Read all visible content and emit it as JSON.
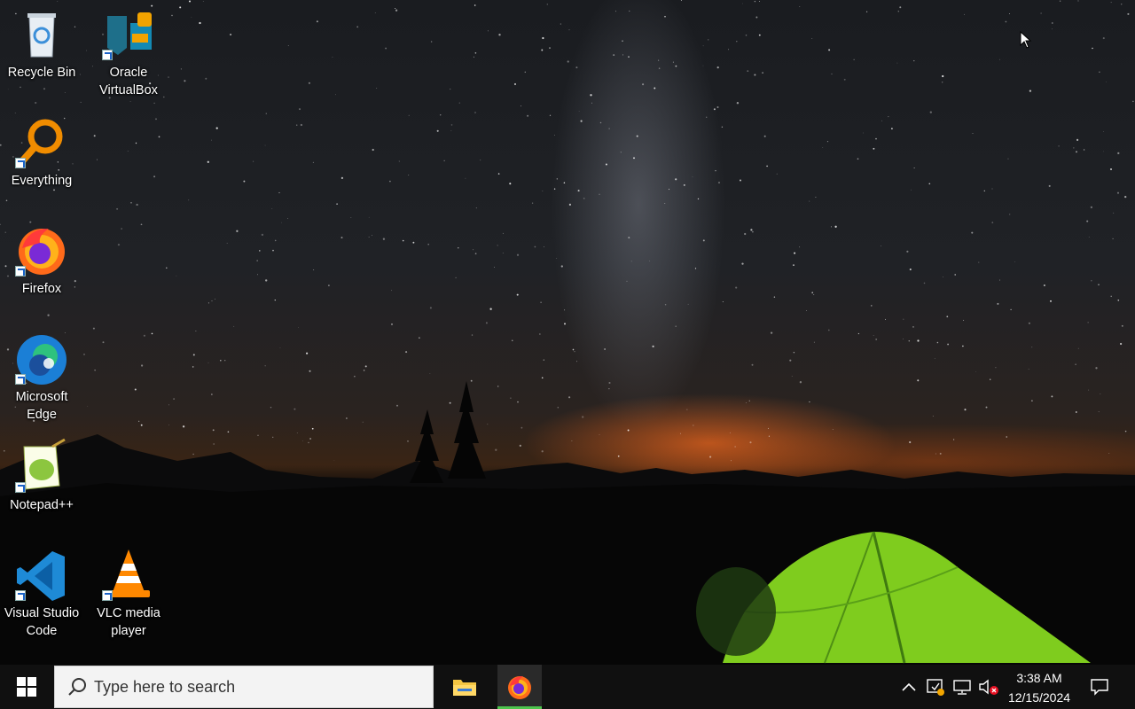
{
  "desktop": {
    "icons": [
      {
        "label": "Recycle Bin",
        "icon": "recycle-bin-icon"
      },
      {
        "label": "Oracle VirtualBox",
        "icon": "virtualbox-icon"
      },
      {
        "label": "Everything",
        "icon": "everything-search-icon"
      },
      {
        "label": "Firefox",
        "icon": "firefox-icon"
      },
      {
        "label": "Microsoft Edge",
        "icon": "edge-icon"
      },
      {
        "label": "Notepad++",
        "icon": "notepadpp-icon"
      },
      {
        "label": "Visual Studio Code",
        "icon": "vscode-icon"
      },
      {
        "label": "VLC media player",
        "icon": "vlc-icon"
      }
    ]
  },
  "taskbar": {
    "search_placeholder": "Type here to search",
    "pinned": [
      {
        "name": "File Explorer",
        "icon": "file-explorer-icon",
        "active": false
      },
      {
        "name": "Firefox",
        "icon": "firefox-icon",
        "active": true
      }
    ],
    "tray_icons": [
      "chevron-up-icon",
      "security-warning-icon",
      "network-icon",
      "volume-muted-icon"
    ],
    "clock": {
      "time": "3:38 AM",
      "date": "12/15/2024"
    },
    "accent": "#4dc44d"
  }
}
